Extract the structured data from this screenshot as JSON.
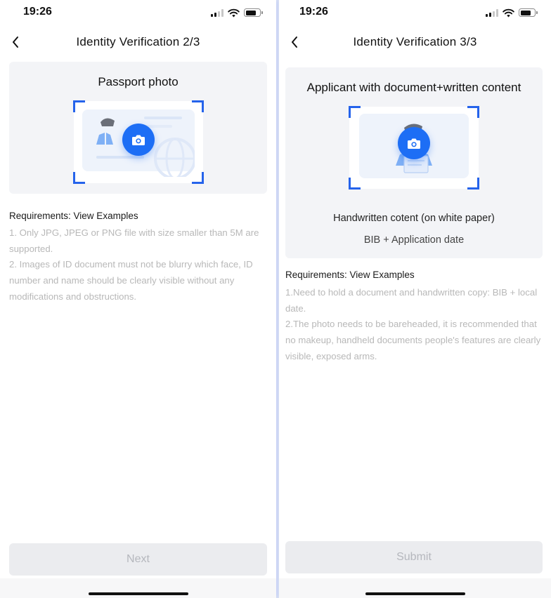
{
  "screens": [
    {
      "status_time": "19:26",
      "nav_title": "Identity Verification 2/3",
      "card_title": "Passport photo",
      "requirements_heading": "Requirements: View Examples",
      "requirements": [
        "1. Only JPG, JPEG or PNG file with size smaller than 5M are supported.",
        "2. Images of ID document must not be blurry which face, ID number and name should be clearly visible without any modifications and obstructions."
      ],
      "button_label": "Next"
    },
    {
      "status_time": "19:26",
      "nav_title": "Identity Verification 3/3",
      "card_title": "Applicant with document+written content",
      "caption_1": "Handwritten cotent (on white paper)",
      "caption_2": "BIB + Application date",
      "requirements_heading": "Requirements: View Examples",
      "requirements": [
        "1.Need to hold a document and handwritten copy: BIB + local date.",
        "2.The photo needs to be bareheaded, it is recommended that no makeup, handheld documents people's features are clearly visible,  exposed arms."
      ],
      "button_label": "Submit"
    }
  ],
  "icons": {
    "back": "chevron-left-icon",
    "camera": "camera-icon",
    "signal": "cellular-signal-icon",
    "wifi": "wifi-icon",
    "battery": "battery-icon"
  },
  "colors": {
    "accent": "#1d6ef5",
    "frame_corner": "#2563eb",
    "card_background": "#f3f4f7",
    "disabled_button": "#ebecef",
    "disabled_text": "#b5b7bd",
    "requirement_text": "#b8b8b8"
  }
}
